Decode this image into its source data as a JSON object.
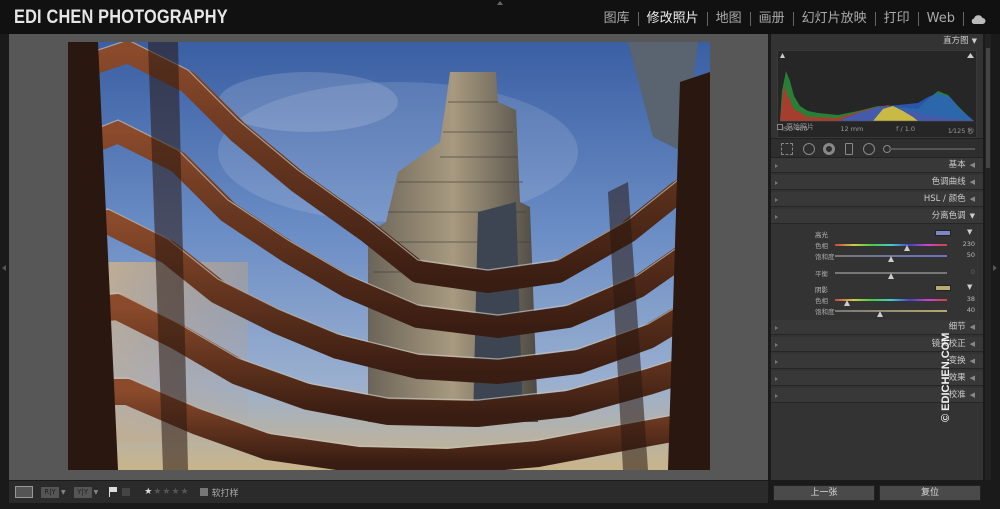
{
  "brand": "EDI CHEN PHOTOGRAPHY",
  "modules": [
    {
      "label": "图库",
      "active": false
    },
    {
      "label": "修改照片",
      "active": true
    },
    {
      "label": "地图",
      "active": false
    },
    {
      "label": "画册",
      "active": false
    },
    {
      "label": "幻灯片放映",
      "active": false
    },
    {
      "label": "打印",
      "active": false
    },
    {
      "label": "Web",
      "active": false
    }
  ],
  "toolbar": {
    "btn_ry": "R|Y",
    "btn_yy": "Y|Y",
    "stars_on": "★",
    "stars_off": "★★★★",
    "rating": 1,
    "soft_proof": "软打样"
  },
  "histogram": {
    "title": "直方图",
    "iso": "ISO 400",
    "focal": "12 mm",
    "aperture": "f / 1.0",
    "shutter": "1⁄125 秒",
    "original_photo": "原始照片"
  },
  "sections": {
    "basic": "基本",
    "tone_curve": "色调曲线",
    "hsl": "HSL / 颜色",
    "split_toning": "分离色调",
    "detail": "细节",
    "lens": "镜头校正",
    "transform": "变换",
    "effects": "效果",
    "calibration": "校准"
  },
  "split_toning": {
    "highlights": "高光",
    "highlight_hue_label": "色相",
    "highlight_hue": 230,
    "highlight_sat_label": "饱和度",
    "highlight_sat": 50,
    "balance_label": "平衡",
    "balance": 0,
    "shadows": "阴影",
    "shadow_hue_label": "色相",
    "shadow_hue": 38,
    "shadow_sat_label": "饱和度",
    "shadow_sat": 40,
    "highlight_color": "#7f86c4",
    "shadow_color": "#b8ab74"
  },
  "buttons": {
    "previous": "上一张",
    "reset": "复位"
  },
  "watermark": "© EDICHEN.COM"
}
